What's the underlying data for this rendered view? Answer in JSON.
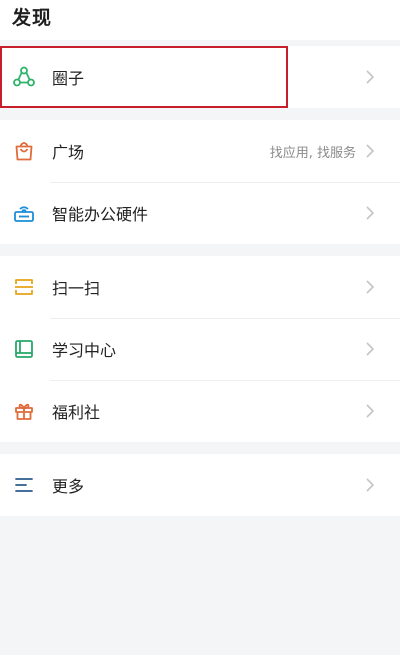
{
  "header": {
    "title": "发现"
  },
  "groups": [
    {
      "items": [
        {
          "label": "圈子",
          "icon": "circle-group-icon",
          "color": "#2db36a"
        }
      ]
    },
    {
      "items": [
        {
          "label": "广场",
          "sub": "找应用, 找服务",
          "icon": "shopping-bag-icon",
          "color": "#e06b3b"
        },
        {
          "label": "智能办公硬件",
          "icon": "router-device-icon",
          "color": "#1c8fd6"
        }
      ]
    },
    {
      "items": [
        {
          "label": "扫一扫",
          "icon": "scan-icon",
          "color": "#e6a418"
        },
        {
          "label": "学习中心",
          "icon": "book-icon",
          "color": "#28a86a"
        },
        {
          "label": "福利社",
          "icon": "gift-icon",
          "color": "#e06b3b"
        }
      ]
    },
    {
      "items": [
        {
          "label": "更多",
          "icon": "menu-lines-icon",
          "color": "#2b5c8f"
        }
      ]
    }
  ],
  "chevron_color": "#c4c4c4",
  "highlight_color": "#c81e2c"
}
